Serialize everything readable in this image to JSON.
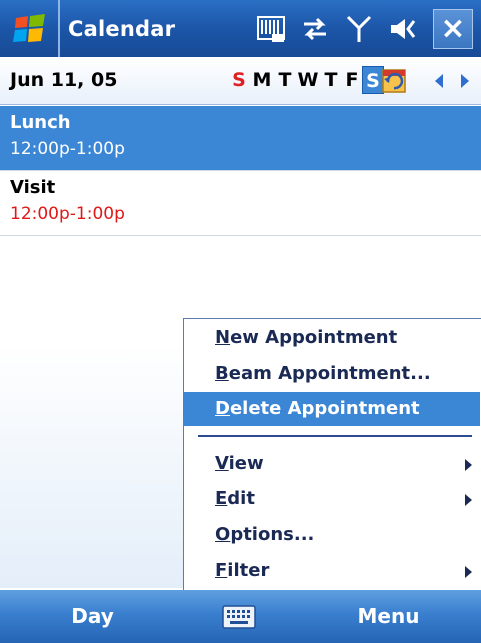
{
  "titlebar": {
    "app_title": "Calendar",
    "icons": [
      "windows-start-icon",
      "input-panel-icon",
      "connectivity-icon",
      "signal-icon",
      "volume-icon",
      "close-icon"
    ],
    "close_glyph": "×"
  },
  "datebar": {
    "date": "Jun 11, 05",
    "days": [
      "S",
      "M",
      "T",
      "W",
      "T",
      "F",
      "S"
    ],
    "selected_day_index": 6,
    "sunday_index": 0
  },
  "appointments": [
    {
      "title": "Lunch",
      "time": "12:00p-1:00p",
      "selected": true
    },
    {
      "title": "Visit",
      "time": "12:00p-1:00p",
      "selected": false,
      "conflict": true
    }
  ],
  "menu": {
    "items": [
      {
        "label_ul": "N",
        "label_rest": "ew Appointment"
      },
      {
        "label_ul": "B",
        "label_rest": "eam Appointment..."
      },
      {
        "label_ul": "D",
        "label_rest": "elete Appointment",
        "highlighted": true
      },
      {
        "label_ul": "V",
        "label_rest": "iew",
        "submenu": true
      },
      {
        "label_ul": "E",
        "label_rest": "dit",
        "submenu": true
      },
      {
        "label_ul": "O",
        "label_rest": "ptions..."
      },
      {
        "label_ul": "F",
        "label_rest": "ilter",
        "submenu": true
      }
    ]
  },
  "softkeys": {
    "left": "Day",
    "right": "Menu"
  },
  "colors": {
    "accent": "#3c86d6",
    "title_bar": "#1c56a8",
    "conflict_text": "#e01818",
    "sunday": "#e02020"
  }
}
